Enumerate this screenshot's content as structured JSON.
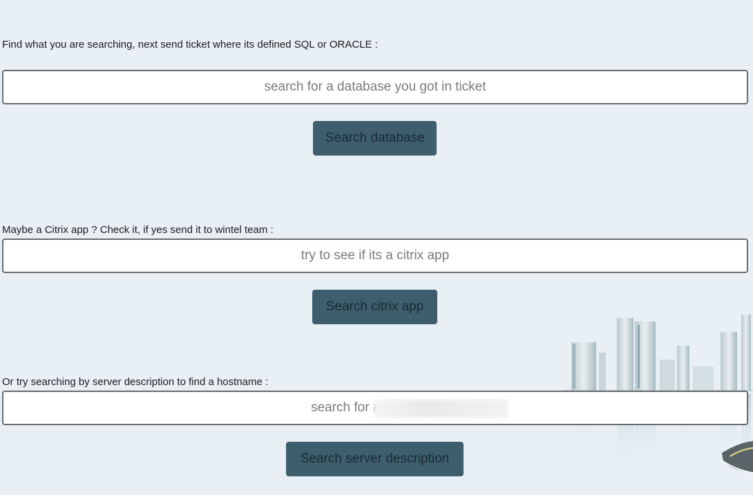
{
  "database_section": {
    "label": "Find what you are searching, next send ticket where its defined SQL or ORACLE :",
    "input_placeholder": "search for a database you got in ticket",
    "button_label": "Search database"
  },
  "citrix_section": {
    "label": "Maybe a Citrix app ? Check it, if yes send it to wintel team :",
    "input_placeholder": "try to see if its a citrix app",
    "button_label": "Search citrix app"
  },
  "server_section": {
    "label": "Or try searching by server description to find a hostname :",
    "input_placeholder": "search for a app like c",
    "button_label": "Search server description"
  },
  "colors": {
    "page_background": "#e8f0f6",
    "button_background": "#3e5e6d",
    "button_text": "#1a2a32"
  },
  "icons": {
    "background_art": "city-skyline-illustration"
  }
}
